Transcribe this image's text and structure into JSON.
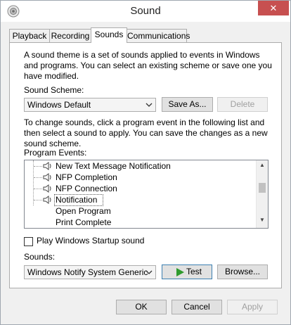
{
  "window": {
    "title": "Sound",
    "close_glyph": "✕"
  },
  "tabs": [
    {
      "label": "Playback"
    },
    {
      "label": "Recording"
    },
    {
      "label": "Sounds",
      "active": true
    },
    {
      "label": "Communications"
    }
  ],
  "sounds_tab": {
    "intro_text": "A sound theme is a set of sounds applied to events in Windows and programs.  You can select an existing scheme or save one you have modified.",
    "intro_lines": [
      "A sound theme is a set of sounds applied to events in Windows",
      "and programs.  You can select an existing scheme or save one you",
      "have modified."
    ],
    "scheme_label": "Sound Scheme:",
    "scheme_value": "Windows Default",
    "save_as_label": "Save As...",
    "delete_label": "Delete",
    "instructions_lines": [
      "To change sounds, click a program event in the following list and",
      "then select a sound to apply.  You can save the changes as a new",
      "sound scheme."
    ],
    "program_events_label": "Program Events:",
    "events": [
      {
        "label": "New Text Message Notification",
        "has_sound": true
      },
      {
        "label": "NFP Completion",
        "has_sound": true
      },
      {
        "label": "NFP Connection",
        "has_sound": true
      },
      {
        "label": "Notification",
        "has_sound": true,
        "selected": true
      },
      {
        "label": "Open Program",
        "has_sound": false
      },
      {
        "label": "Print Complete",
        "has_sound": false
      }
    ],
    "startup_checkbox_label": "Play Windows Startup sound",
    "startup_checked": false,
    "sounds_label": "Sounds:",
    "sound_value": "Windows Notify System Generic",
    "test_label": "Test",
    "browse_label": "Browse..."
  },
  "footer": {
    "ok_label": "OK",
    "cancel_label": "Cancel",
    "apply_label": "Apply"
  },
  "icons": {
    "app": "speaker-app-icon",
    "speaker": "speaker-icon",
    "play": "play-icon",
    "dropdown": "chevron-down-icon"
  },
  "colors": {
    "close_button": "#c75050",
    "play_green": "#2e9b2e",
    "window_border": "#9fa7b0"
  }
}
